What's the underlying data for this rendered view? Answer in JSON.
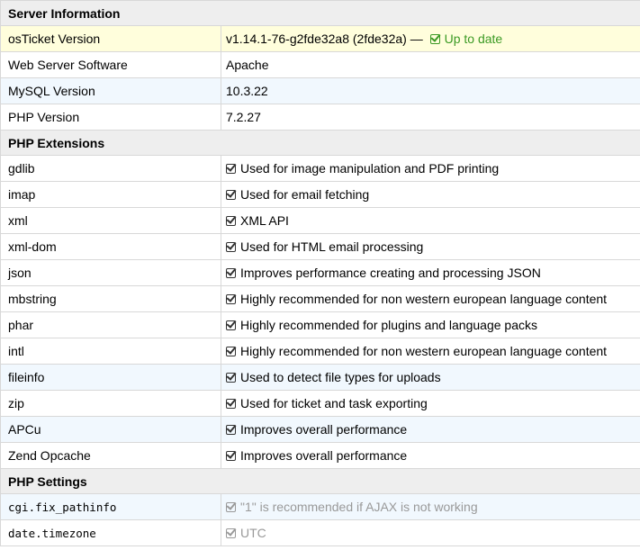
{
  "sections": {
    "server": {
      "title": "Server Information",
      "rows": [
        {
          "key": "osTicket Version",
          "value": "v1.14.1-76-g2fde32a8 (2fde32a) —",
          "status": "Up to date"
        },
        {
          "key": "Web Server Software",
          "value": "Apache"
        },
        {
          "key": "MySQL Version",
          "value": "10.3.22"
        },
        {
          "key": "PHP Version",
          "value": "7.2.27"
        }
      ]
    },
    "extensions": {
      "title": "PHP Extensions",
      "rows": [
        {
          "key": "gdlib",
          "value": "Used for image manipulation and PDF printing"
        },
        {
          "key": "imap",
          "value": "Used for email fetching"
        },
        {
          "key": "xml",
          "value": "XML API"
        },
        {
          "key": "xml-dom",
          "value": "Used for HTML email processing"
        },
        {
          "key": "json",
          "value": "Improves performance creating and processing JSON"
        },
        {
          "key": "mbstring",
          "value": "Highly recommended for non western european language content"
        },
        {
          "key": "phar",
          "value": "Highly recommended for plugins and language packs"
        },
        {
          "key": "intl",
          "value": "Highly recommended for non western european language content"
        },
        {
          "key": "fileinfo",
          "value": "Used to detect file types for uploads"
        },
        {
          "key": "zip",
          "value": "Used for ticket and task exporting"
        },
        {
          "key": "APCu",
          "value": "Improves overall performance"
        },
        {
          "key": "Zend Opcache",
          "value": "Improves overall performance"
        }
      ]
    },
    "settings": {
      "title": "PHP Settings",
      "rows": [
        {
          "key": "cgi.fix_pathinfo",
          "value": "\"1\" is recommended if AJAX is not working"
        },
        {
          "key": "date.timezone",
          "value": "UTC"
        }
      ]
    }
  },
  "colors": {
    "header_bg": "#eeeeee",
    "row_alt_bg": "#f1f8fe",
    "highlight_bg": "#fffedc",
    "ok_green": "#3b9a24",
    "muted_grey": "#999999"
  },
  "icons": {
    "check": "checkbox-checked-icon"
  }
}
